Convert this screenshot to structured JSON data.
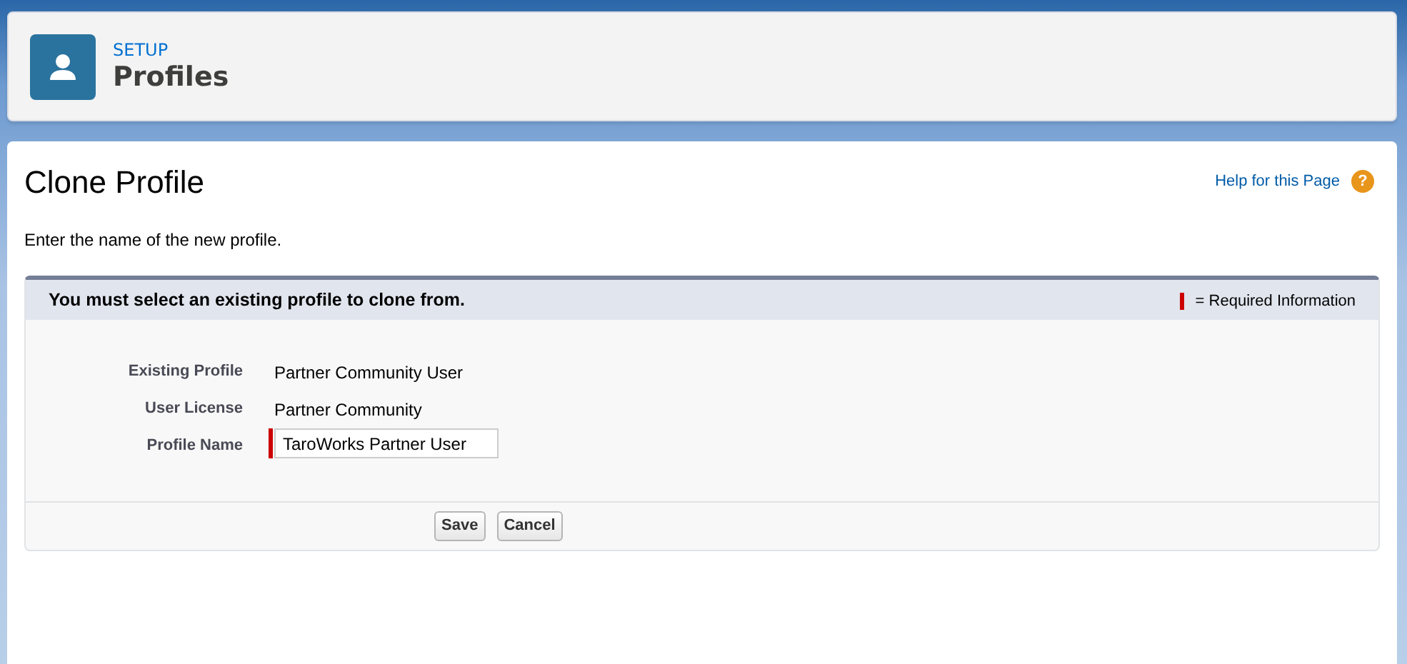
{
  "header": {
    "eyebrow": "SETUP",
    "title": "Profiles"
  },
  "page": {
    "title": "Clone Profile",
    "help_link": "Help for this Page",
    "help_icon": "?",
    "instruction": "Enter the name of the new profile."
  },
  "section": {
    "message": "You must select an existing profile to clone from.",
    "legend": "= Required Information",
    "fields": [
      {
        "label": "Existing Profile",
        "kind": "text",
        "value": "Partner Community User",
        "required": false
      },
      {
        "label": "User License",
        "kind": "text",
        "value": "Partner Community",
        "required": false
      },
      {
        "label": "Profile Name",
        "kind": "input",
        "value": "TaroWorks Partner User",
        "required": true
      }
    ],
    "buttons": [
      "Save",
      "Cancel"
    ]
  }
}
